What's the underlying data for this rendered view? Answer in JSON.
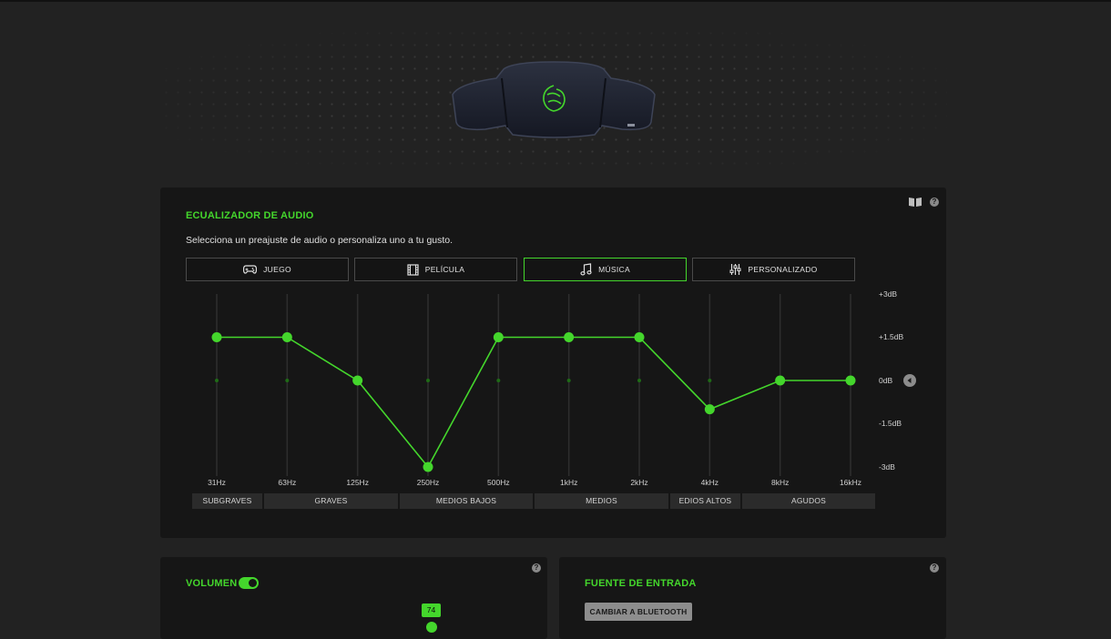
{
  "eq": {
    "title": "ECUALIZADOR DE AUDIO",
    "subtitle": "Selecciona un preajuste de audio o personaliza uno a tu gusto.",
    "presets": [
      {
        "label": "JUEGO",
        "icon": "gamepad-icon",
        "active": false
      },
      {
        "label": "PELÍCULA",
        "icon": "film-icon",
        "active": false
      },
      {
        "label": "MÚSICA",
        "icon": "music-note-icon",
        "active": true
      },
      {
        "label": "PERSONALIZADO",
        "icon": "sliders-icon",
        "active": false
      }
    ],
    "frequencies": [
      "31Hz",
      "63Hz",
      "125Hz",
      "250Hz",
      "500Hz",
      "1kHz",
      "2kHz",
      "4kHz",
      "8kHz",
      "16kHz"
    ],
    "gains_db": [
      1.5,
      1.5,
      0,
      -3,
      1.5,
      1.5,
      1.5,
      -1,
      0,
      0
    ],
    "db_range": [
      -3,
      3
    ],
    "db_labels": [
      "+3dB",
      "+1.5dB",
      "0dB",
      "-1.5dB",
      "-3dB"
    ],
    "bands": [
      "SUBGRAVES",
      "GRAVES",
      "MEDIOS BAJOS",
      "MEDIOS",
      "EDIOS ALTOS",
      "AGUDOS"
    ],
    "help": "?"
  },
  "volume": {
    "title": "VOLUMEN",
    "enabled": true,
    "value": "74",
    "help": "?"
  },
  "input_source": {
    "title": "FUENTE DE ENTRADA",
    "button_label": "CAMBIAR A BLUETOOTH",
    "help": "?"
  },
  "colors": {
    "accent": "#44d62c",
    "panel": "#161616",
    "background": "#222222"
  }
}
